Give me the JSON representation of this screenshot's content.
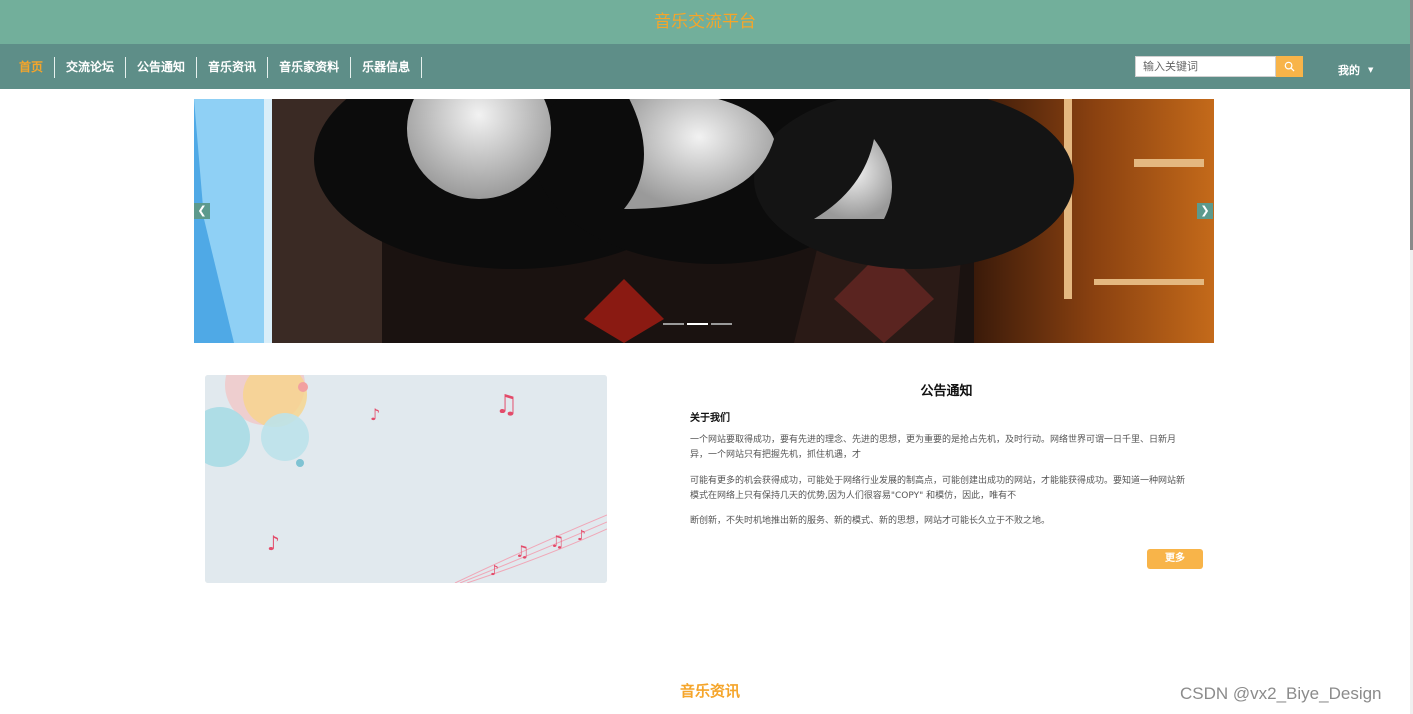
{
  "site_title": "音乐交流平台",
  "nav": {
    "items": [
      {
        "label": "首页",
        "active": true
      },
      {
        "label": "交流论坛"
      },
      {
        "label": "公告通知"
      },
      {
        "label": "音乐资讯"
      },
      {
        "label": "音乐家资料"
      },
      {
        "label": "乐器信息"
      }
    ]
  },
  "search": {
    "placeholder": "输入关键词",
    "icon": "search-icon"
  },
  "user_menu": {
    "label": "我的",
    "icon": "caret-down-icon"
  },
  "carousel": {
    "slide_count": 3,
    "active_slide": 2,
    "prev_icon": "chevron-left-icon",
    "next_icon": "chevron-right-icon"
  },
  "notice": {
    "title": "公告通知",
    "heading": "关于我们",
    "paragraphs": [
      "一个网站要取得成功，要有先进的理念、先进的思想，更为重要的是抢占先机，及时行动。网络世界可谓一日千里、日新月异，一个网站只有把握先机，抓住机遇，才",
      "可能有更多的机会获得成功，可能处于网络行业发展的制高点，可能创建出成功的网站，才能能获得成功。要知道一种网站新模式在网络上只有保持几天的优势,因为人们很容易\"COPY\" 和模仿，因此，唯有不",
      "断创新，不失时机地推出新的服务、新的模式、新的思想，网站才可能长久立于不败之地。"
    ],
    "more_label": "更多"
  },
  "section_title": "音乐资讯",
  "watermark": "CSDN @vx2_Biye_Design",
  "colors": {
    "header_bg": "#72af9b",
    "nav_bg": "#5e8e88",
    "accent": "#f5a52a",
    "button": "#f8b449"
  }
}
